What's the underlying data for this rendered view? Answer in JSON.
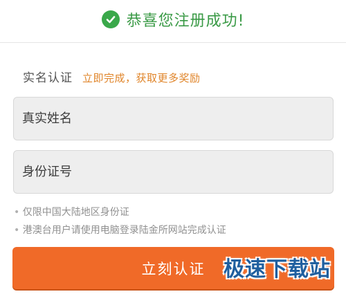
{
  "header": {
    "icon": "check-circle-icon",
    "success_text": "恭喜您注册成功!",
    "success_color": "#3aa84a"
  },
  "verification": {
    "title": "实名认证",
    "promo": "立即完成，获取更多奖励",
    "promo_color": "#e0852a"
  },
  "form": {
    "name_placeholder": "真实姓名",
    "id_placeholder": "身份证号"
  },
  "notes": [
    "仅限中国大陆地区身份证",
    "港澳台用户请使用电脑登录陆金所网站完成认证"
  ],
  "submit": {
    "label": "立刻认证",
    "color": "#f06a28"
  },
  "watermark": {
    "text": "极速下载站"
  }
}
